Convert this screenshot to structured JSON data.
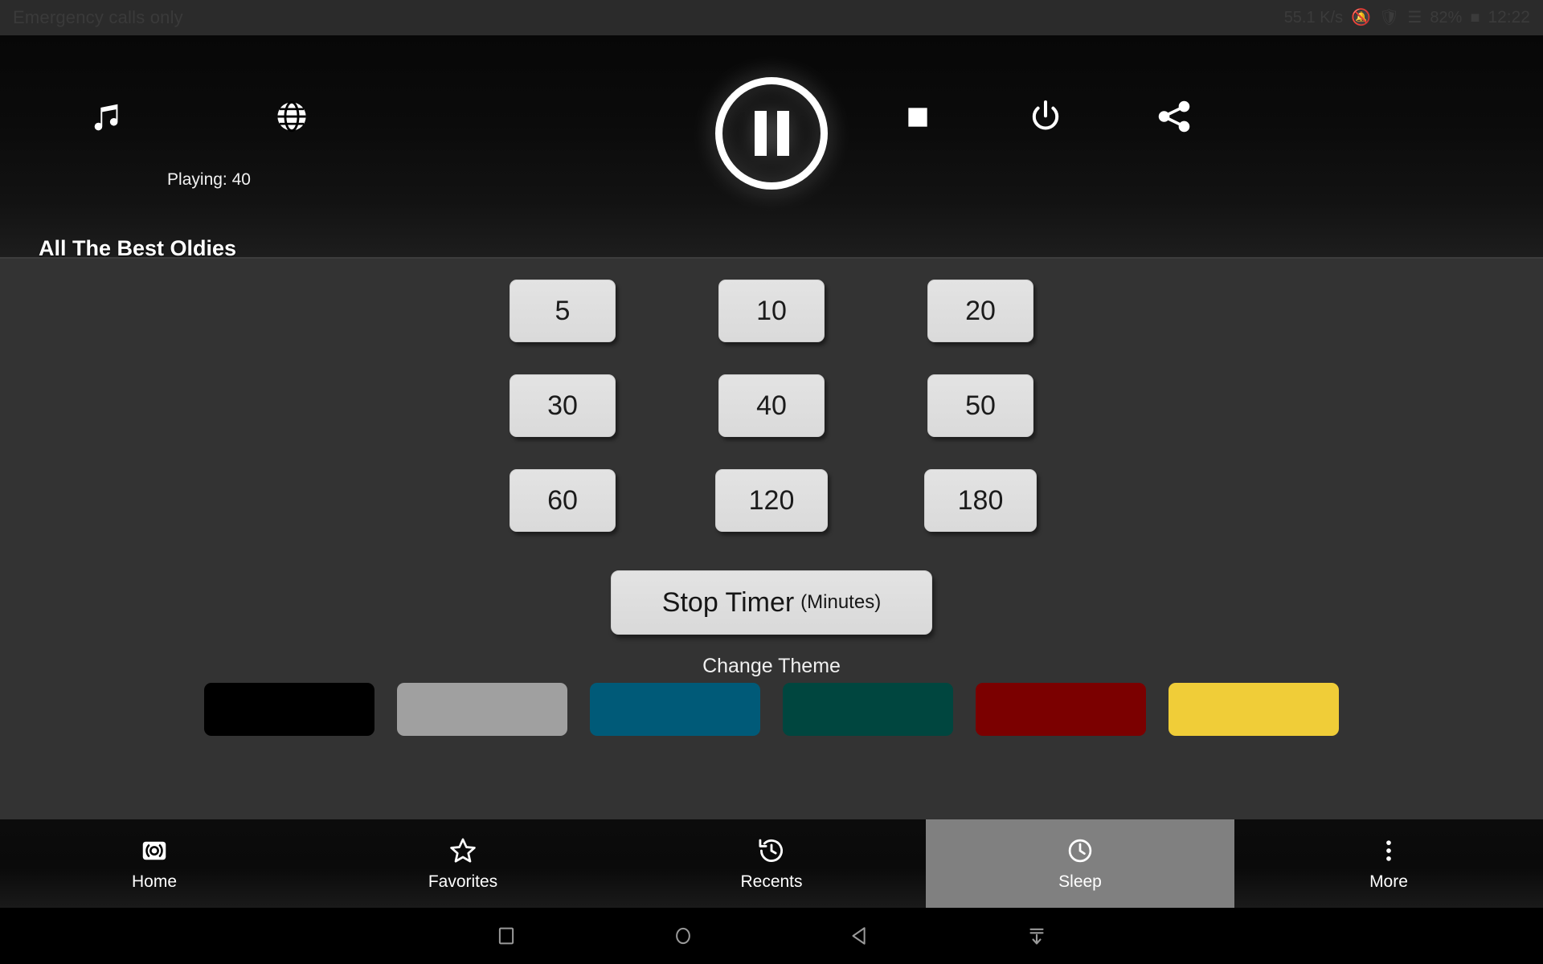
{
  "status_bar": {
    "carrier_text": "Emergency calls only",
    "indicators": [
      "55.1 K/s",
      "vibrate-icon",
      "shield-icon",
      "wifi-icon"
    ],
    "battery_percent": "82%",
    "battery_icon": "battery-icon",
    "clock": "12:22"
  },
  "player": {
    "music_icon": "music-note-icon",
    "playing_label": "Playing: 40",
    "globe_icon": "globe-icon",
    "playpause_icon": "pause-icon",
    "stop_icon": "stop-square-icon",
    "power_icon": "power-icon",
    "share_icon": "share-icon",
    "station_title": "All The Best Oldies"
  },
  "sleep_timer": {
    "options": [
      "5",
      "10",
      "20",
      "30",
      "40",
      "50",
      "60",
      "120",
      "180"
    ],
    "stop_button": {
      "main": "Stop Timer",
      "suffix": "(Minutes)"
    }
  },
  "theme": {
    "heading": "Change Theme",
    "swatches": [
      {
        "name": "black",
        "color": "#000000"
      },
      {
        "name": "gray",
        "color": "#a0a0a0"
      },
      {
        "name": "blue",
        "color": "#005a78"
      },
      {
        "name": "green",
        "color": "#00463f"
      },
      {
        "name": "red",
        "color": "#7b0000"
      },
      {
        "name": "yellow",
        "color": "#f0cd38"
      }
    ]
  },
  "bottom_nav": {
    "items": [
      {
        "label": "Home",
        "icon": "broadcast-icon",
        "active": false
      },
      {
        "label": "Favorites",
        "icon": "star-icon",
        "active": false
      },
      {
        "label": "Recents",
        "icon": "history-icon",
        "active": false
      },
      {
        "label": "Sleep",
        "icon": "clock-icon",
        "active": true
      },
      {
        "label": "More",
        "icon": "overflow-dots-icon",
        "active": false
      }
    ]
  },
  "system_nav": {
    "buttons": [
      "recents-square-icon",
      "home-circle-icon",
      "back-triangle-icon",
      "hide-keyboard-icon"
    ]
  }
}
